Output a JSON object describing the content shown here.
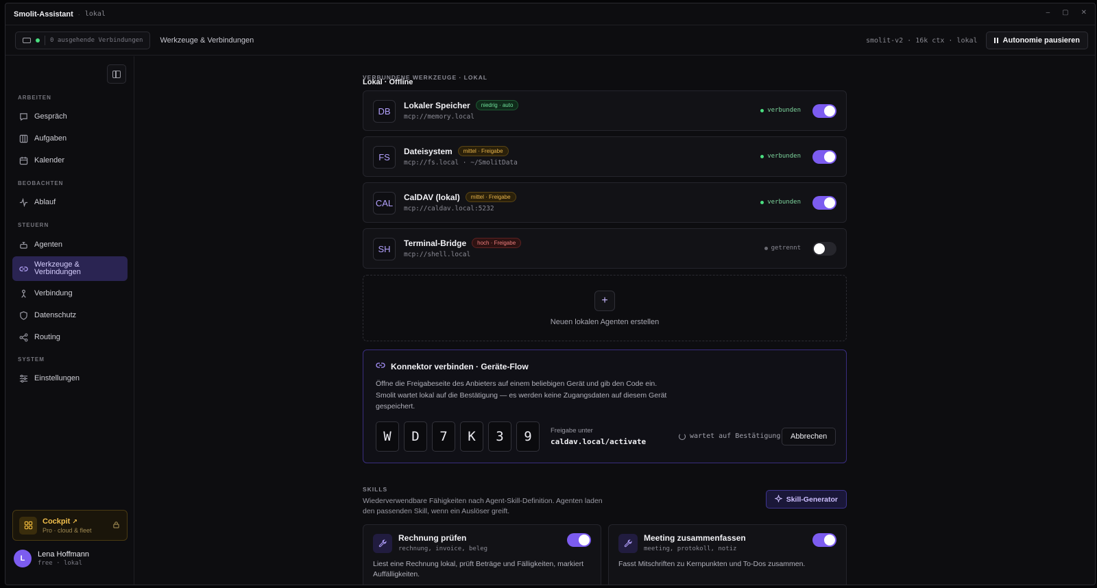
{
  "titlebar": {
    "app": "Smolit-Assistant",
    "separator": "·",
    "env": "lokal",
    "controls": [
      "–",
      "▢",
      "✕"
    ]
  },
  "topbar": {
    "status_main": "Lokal · Offline",
    "status_sub": "0 ausgehende Verbindungen",
    "crumb": "Werkzeuge & Verbindungen",
    "model": "smolit-v2 · 16k ctx · lokal",
    "pause_label": "Autonomie pausieren"
  },
  "sidebar": {
    "sections": {
      "arbeiten": "ARBEITEN",
      "beobachten": "BEOBACHTEN",
      "steuern": "STEUERN",
      "system": "SYSTEM"
    },
    "items": {
      "gespraech": "Gespräch",
      "aufgaben": "Aufgaben",
      "kalender": "Kalender",
      "ablauf": "Ablauf",
      "agenten": "Agenten",
      "werkzeuge_l1": "Werkzeuge &",
      "werkzeuge_l2": "Verbindungen",
      "verbindung": "Verbindung",
      "datenschutz": "Datenschutz",
      "routing": "Routing",
      "einstellungen": "Einstellungen"
    },
    "cockpit": {
      "title": "Cockpit",
      "arrow": "↗",
      "subtitle": "Pro · cloud & fleet"
    },
    "user": {
      "initial": "L",
      "name": "Lena Hoffmann",
      "plan": "free · lokal"
    }
  },
  "tools": {
    "header": "VERBUNDENE WERKZEUGE · LOKAL",
    "list": [
      {
        "abbr": "DB",
        "name": "Lokaler Speicher",
        "tag": "niedrig · auto",
        "uri": "mcp://memory.local",
        "status": "verbunden",
        "enabled": true
      },
      {
        "abbr": "FS",
        "name": "Dateisystem",
        "tag": "mittel · Freigabe",
        "uri": "mcp://fs.local · ~/SmolitData",
        "status": "verbunden",
        "enabled": true
      },
      {
        "abbr": "CAL",
        "name": "CalDAV (lokal)",
        "tag": "mittel · Freigabe",
        "uri": "mcp://caldav.local:5232",
        "status": "verbunden",
        "enabled": true
      },
      {
        "abbr": "SH",
        "name": "Terminal-Bridge",
        "tag": "hoch · Freigabe",
        "uri": "mcp://shell.local",
        "status": "getrennt",
        "enabled": false
      }
    ],
    "add_label": "Neuen lokalen Agenten erstellen",
    "add_symbol": "+"
  },
  "connector": {
    "title": "Konnektor verbinden · Geräte-Flow",
    "desc": "Öffne die Freigabeseite des Anbieters auf einem beliebigen Gerät und gib den Code ein. Smolit wartet lokal auf die Bestätigung — es werden keine Zugangsdaten auf diesem Gerät gespeichert.",
    "code": [
      "W",
      "D",
      "7",
      "K",
      "3",
      "9"
    ],
    "release_label": "Freigabe unter",
    "release_url": "caldav.local/activate",
    "waiting": "wartet auf Bestätigung",
    "cancel": "Abbrechen"
  },
  "skills": {
    "header": "SKILLS",
    "subtitle": "Wiederverwendbare Fähigkeiten nach Agent-Skill-Definition. Agenten laden den passenden Skill, wenn ein Auslöser greift.",
    "generator": "Skill-Generator",
    "list": [
      {
        "name": "Rechnung prüfen",
        "keywords": "rechnung, invoice, beleg",
        "text": "Liest eine Rechnung lokal, prüft Beträge und Fälligkeiten, markiert Auffälligkeiten.",
        "enabled": true
      },
      {
        "name": "Meeting zusammenfassen",
        "keywords": "meeting, protokoll, notiz",
        "text": "Fasst Mitschriften zu Kernpunkten und To-Dos zusammen.",
        "enabled": true
      }
    ]
  },
  "colors": {
    "accent": "#7c5cf0",
    "ok": "#4ade80",
    "warn": "#eab54a",
    "danger": "#f07d7d",
    "cockpit": "#f3c04d"
  },
  "icons": {
    "nav": [
      "chat-bubble-icon",
      "columns-icon",
      "calendar-icon",
      "activity-icon",
      "robot-icon",
      "link-icon",
      "person-icon",
      "shield-icon",
      "share-icon",
      "sliders-icon"
    ],
    "tool_toggle": "switch",
    "skill": "wrench-icon"
  }
}
